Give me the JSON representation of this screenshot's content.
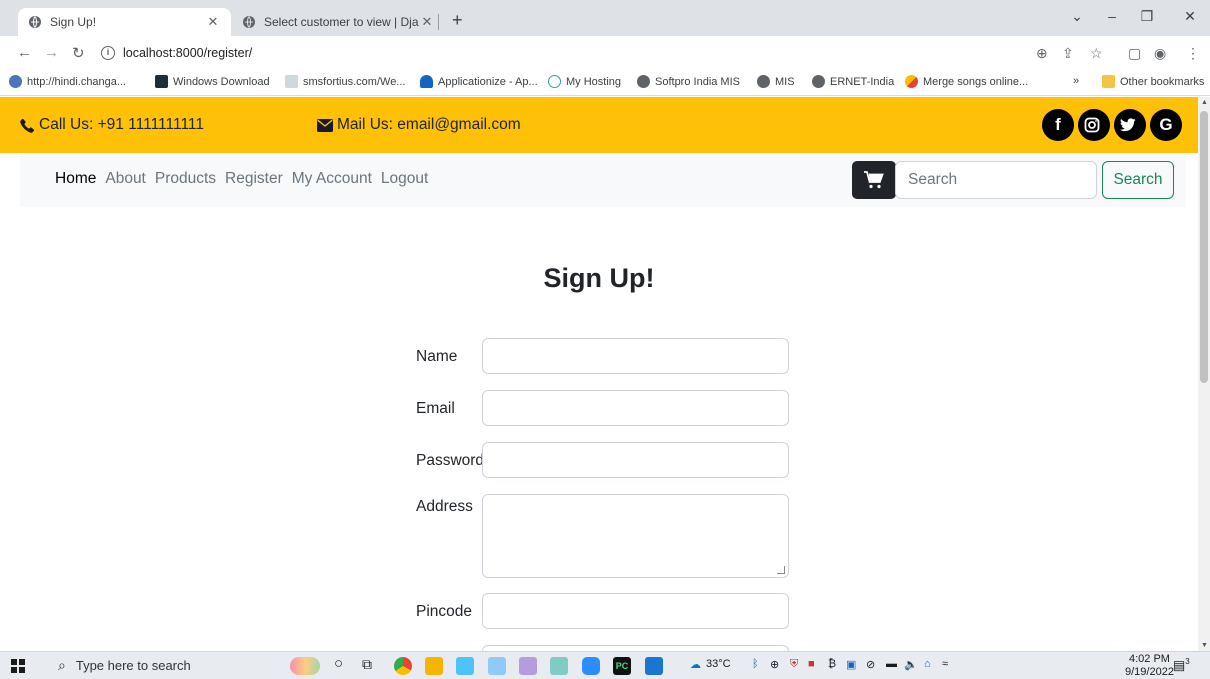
{
  "browser": {
    "tabs": [
      {
        "title": "Sign Up!",
        "active": true
      },
      {
        "title": "Select customer to view | Django",
        "active": false
      }
    ],
    "url": "localhost:8000/register/",
    "bookmarks": [
      "http://hindi.changa...",
      "Windows Download",
      "smsfortius.com/We...",
      "Applicationize - Ap...",
      "My Hosting",
      "Softpro India MIS",
      "MIS",
      "ERNET-India",
      "Merge songs online..."
    ],
    "more_bookmarks": "»",
    "other_bookmarks": "Other bookmarks"
  },
  "topbar": {
    "call": "Call Us: +91 1111111111",
    "mail": "Mail Us: email@gmail.com",
    "social_icons": [
      "facebook-icon",
      "instagram-icon",
      "twitter-icon",
      "google-icon"
    ],
    "social_letters": [
      "f",
      "◎",
      "t",
      "G"
    ]
  },
  "navbar": {
    "links": [
      "Home",
      "About",
      "Products",
      "Register",
      "My Account",
      "Logout"
    ],
    "search_placeholder": "Search",
    "search_button": "Search"
  },
  "page": {
    "heading": "Sign Up!",
    "fields": [
      {
        "label": "Name",
        "value": ""
      },
      {
        "label": "Email",
        "value": ""
      },
      {
        "label": "Password",
        "value": ""
      },
      {
        "label": "Address",
        "value": ""
      },
      {
        "label": "Pincode",
        "value": ""
      }
    ]
  },
  "taskbar": {
    "search_placeholder": "Type here to search",
    "weather": "33°C",
    "time": "4:02 PM",
    "date": "9/19/2022",
    "notifications": "3"
  },
  "colors": {
    "topbar": "#ffc107",
    "navbar": "#f8f9fa",
    "search_button": "#198754",
    "cart_button": "#212529"
  }
}
